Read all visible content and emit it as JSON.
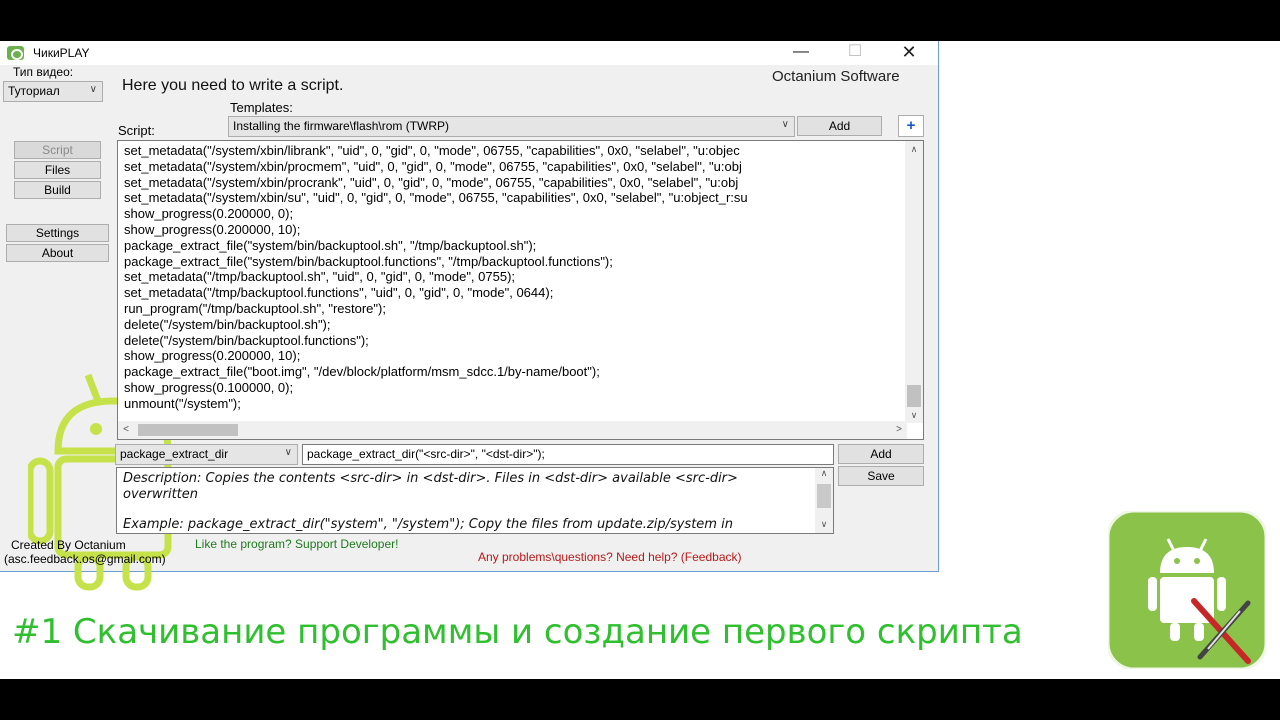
{
  "window": {
    "title": "ЧикиPLAY",
    "controls": {
      "minimize": "—",
      "maximize": "☐",
      "close": "✕"
    }
  },
  "sidebar": {
    "video_type_label": "Тип видео:",
    "video_type_value": "Туториал",
    "items": [
      {
        "label": "Script",
        "state": "disabled"
      },
      {
        "label": "Files"
      },
      {
        "label": "Build"
      },
      {
        "label": "Settings"
      },
      {
        "label": "About"
      }
    ]
  },
  "main": {
    "heading": "Here you need to write a script.",
    "brand": "Octanium Software",
    "templates_label": "Templates:",
    "script_label": "Script:",
    "template_selected": "Installing the firmware\\flash\\rom (TWRP)",
    "add_template_label": "Add",
    "plus_label": "+"
  },
  "script_lines": [
    "set_metadata(\"/system/xbin/librank\", \"uid\", 0, \"gid\", 0, \"mode\", 06755, \"capabilities\", 0x0, \"selabel\", \"u:objec",
    "set_metadata(\"/system/xbin/procmem\", \"uid\", 0, \"gid\", 0, \"mode\", 06755, \"capabilities\", 0x0, \"selabel\", \"u:obj",
    "set_metadata(\"/system/xbin/procrank\", \"uid\", 0, \"gid\", 0, \"mode\", 06755, \"capabilities\", 0x0, \"selabel\", \"u:obj",
    "set_metadata(\"/system/xbin/su\", \"uid\", 0, \"gid\", 0, \"mode\", 06755, \"capabilities\", 0x0, \"selabel\", \"u:object_r:su",
    "show_progress(0.200000, 0);",
    "show_progress(0.200000, 10);",
    "package_extract_file(\"system/bin/backuptool.sh\", \"/tmp/backuptool.sh\");",
    "package_extract_file(\"system/bin/backuptool.functions\", \"/tmp/backuptool.functions\");",
    "set_metadata(\"/tmp/backuptool.sh\", \"uid\", 0, \"gid\", 0, \"mode\", 0755);",
    "set_metadata(\"/tmp/backuptool.functions\", \"uid\", 0, \"gid\", 0, \"mode\", 0644);",
    "run_program(\"/tmp/backuptool.sh\", \"restore\");",
    "delete(\"/system/bin/backuptool.sh\");",
    "delete(\"/system/bin/backuptool.functions\");",
    "show_progress(0.200000, 10);",
    "package_extract_file(\"boot.img\", \"/dev/block/platform/msm_sdcc.1/by-name/boot\");",
    "show_progress(0.100000, 0);",
    "unmount(\"/system\");"
  ],
  "command": {
    "selected": "package_extract_dir",
    "value": "package_extract_dir(\"<src-dir>\", \"<dst-dir>\");",
    "add_label": "Add",
    "save_label": "Save"
  },
  "description": {
    "line1": "Description: Copies the contents <src-dir> in <dst-dir>. Files in <dst-dir> available <src-dir>",
    "line2": "overwritten",
    "line3": "Example: package_extract_dir(\"system\", \"/system\"); Copy the files from update.zip/system in"
  },
  "footer": {
    "created_by": "Created By Octanium",
    "email": "(asc.feedback.os@gmail.com)",
    "support": "Like the program? Support Developer!",
    "feedback": "Any problems\\questions? Need help? (Feedback)"
  },
  "caption": "#1 Скачивание программы и создание первого скрипта",
  "colors": {
    "caption": "#2fbf2f",
    "mascot": "#c6e24a",
    "logo_bg": "#8bc34a",
    "link_green": "#1f7a1f",
    "link_red": "#b51a1a"
  }
}
